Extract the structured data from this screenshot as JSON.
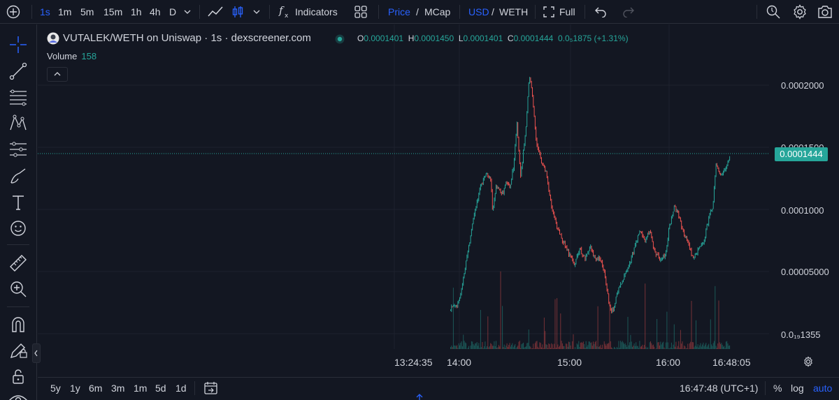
{
  "toolbar": {
    "timeframes": [
      "1s",
      "1m",
      "5m",
      "15m",
      "1h",
      "4h",
      "D"
    ],
    "active_timeframe": "1s",
    "indicators_label": "Indicators",
    "price_label": "Price",
    "slash1": "/",
    "mcap_label": "MCap",
    "usd_label": "USD",
    "slash2": "/",
    "weth_label": "WETH",
    "full_label": "Full"
  },
  "legend": {
    "title": "VUTALEK/WETH on Uniswap · 1s · dexscreener.com",
    "o_label": "O",
    "o_value": "0.0001401",
    "h_label": "H",
    "h_value": "0.0001450",
    "l_label": "L",
    "l_value": "0.0001401",
    "c_label": "C",
    "c_value": "0.0001444",
    "change": "0.0₅1875 (+1.31%)",
    "volume_label": "Volume",
    "volume_value": "158"
  },
  "price_axis": {
    "labels": [
      "0.0002000",
      "0.0001500",
      "0.0001000",
      "0.00005000",
      "0.0₁₉1355"
    ],
    "current_price": "0.0001444"
  },
  "time_axis": {
    "labels": [
      "13:24:35",
      "14:00",
      "15:00",
      "16:00",
      "16:48:05"
    ]
  },
  "bottom": {
    "ranges": [
      "5y",
      "1y",
      "6m",
      "3m",
      "1m",
      "5d",
      "1d"
    ],
    "clock": "16:47:48 (UTC+1)",
    "percent_label": "%",
    "log_label": "log",
    "auto_label": "auto"
  },
  "colors": {
    "up": "#26a69a",
    "down": "#ef5350",
    "background": "#131722",
    "accent": "#2962ff"
  },
  "chart_data": {
    "type": "candlestick",
    "interval": "1s",
    "x_range": [
      "13:24:35",
      "16:48:05"
    ],
    "price_path": [
      [
        "13:55",
        1.85e-05
      ],
      [
        "13:56",
        2.25e-05
      ],
      [
        "13:58",
        2.2e-05
      ],
      [
        "14:00",
        2.65e-05
      ],
      [
        "14:03",
        5e-05
      ],
      [
        "14:06",
        7.5e-05
      ],
      [
        "14:09",
        0.0001
      ],
      [
        "14:12",
        0.000118
      ],
      [
        "14:15",
        0.000128
      ],
      [
        "14:18",
        0.000125
      ],
      [
        "14:19",
        9.8e-05
      ],
      [
        "14:21",
        0.000118
      ],
      [
        "14:23",
        0.000116
      ],
      [
        "14:25",
        0.000112
      ],
      [
        "14:27",
        0.000122
      ],
      [
        "14:29",
        0.000118
      ],
      [
        "14:31",
        0.000135
      ],
      [
        "14:33",
        0.000168
      ],
      [
        "14:35",
        0.000125
      ],
      [
        "14:38",
        0.000165
      ],
      [
        "14:40",
        0.000208
      ],
      [
        "14:42",
        0.00019
      ],
      [
        "14:44",
        0.000155
      ],
      [
        "14:47",
        0.000138
      ],
      [
        "14:50",
        0.000128
      ],
      [
        "14:53",
        0.0001
      ],
      [
        "14:56",
        8.5e-05
      ],
      [
        "14:59",
        7.5e-05
      ],
      [
        "15:03",
        6.3e-05
      ],
      [
        "15:06",
        5.6e-05
      ],
      [
        "15:09",
        6.8e-05
      ],
      [
        "15:12",
        6e-05
      ],
      [
        "15:15",
        7e-05
      ],
      [
        "15:18",
        5.8e-05
      ],
      [
        "15:20",
        6.3e-05
      ],
      [
        "15:23",
        5e-05
      ],
      [
        "15:26",
        2.1e-05
      ],
      [
        "15:28",
        1.8e-05
      ],
      [
        "15:30",
        3.2e-05
      ],
      [
        "15:34",
        4.5e-05
      ],
      [
        "15:37",
        5.5e-05
      ],
      [
        "15:40",
        6.8e-05
      ],
      [
        "15:43",
        8.3e-05
      ],
      [
        "15:46",
        7.5e-05
      ],
      [
        "15:49",
        8.3e-05
      ],
      [
        "15:52",
        6.5e-05
      ],
      [
        "15:55",
        6e-05
      ],
      [
        "15:58",
        6.3e-05
      ],
      [
        "16:00",
        8.5e-05
      ],
      [
        "16:03",
        0.000103
      ],
      [
        "16:05",
        9.8e-05
      ],
      [
        "16:08",
        8.2e-05
      ],
      [
        "16:11",
        7.2e-05
      ],
      [
        "16:14",
        6e-05
      ],
      [
        "16:17",
        6.8e-05
      ],
      [
        "16:20",
        7.5e-05
      ],
      [
        "16:23",
        9.5e-05
      ],
      [
        "16:25",
        0.000102
      ],
      [
        "16:27",
        0.000138
      ],
      [
        "16:29",
        0.000128
      ],
      [
        "16:32",
        0.000131
      ],
      [
        "16:35",
        0.0001444
      ]
    ],
    "volume_range": [
      0,
      158
    ]
  }
}
